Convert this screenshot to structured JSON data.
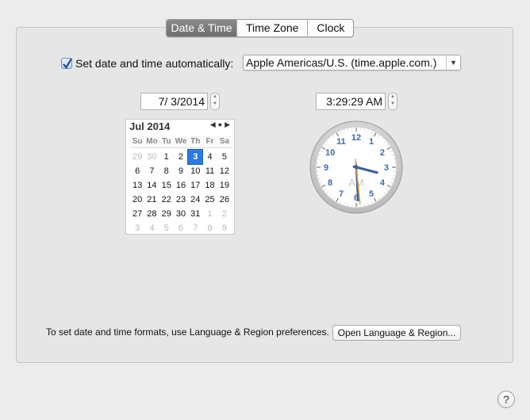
{
  "tabs": [
    "Date & Time",
    "Time Zone",
    "Clock"
  ],
  "active_tab": "Date & Time",
  "auto": {
    "checked": true,
    "label": "Set date and time automatically:"
  },
  "server": {
    "value": "Apple Americas/U.S. (time.apple.com.)"
  },
  "date_field": {
    "value": "7/  3/2014"
  },
  "time_field": {
    "value": "3:29:29 AM"
  },
  "calendar": {
    "title": "Jul 2014",
    "weekdays": [
      "Su",
      "Mo",
      "Tu",
      "We",
      "Th",
      "Fr",
      "Sa"
    ],
    "weeks": [
      [
        "29",
        "30",
        "1",
        "2",
        "3",
        "4",
        "5"
      ],
      [
        "6",
        "7",
        "8",
        "9",
        "10",
        "11",
        "12"
      ],
      [
        "13",
        "14",
        "15",
        "16",
        "17",
        "18",
        "19"
      ],
      [
        "20",
        "21",
        "22",
        "23",
        "24",
        "25",
        "26"
      ],
      [
        "27",
        "28",
        "29",
        "30",
        "31",
        "1",
        "2"
      ],
      [
        "3",
        "4",
        "5",
        "6",
        "7",
        "8",
        "9"
      ]
    ],
    "selected_day": "3"
  },
  "clock": {
    "numbers": [
      "12",
      "1",
      "2",
      "3",
      "4",
      "5",
      "6",
      "7",
      "8",
      "9",
      "10",
      "11"
    ],
    "ampm": "AM",
    "hour": 3,
    "minute": 29,
    "second": 29
  },
  "footer": {
    "text": "To set date and time formats, use Language & Region preferences.",
    "button": "Open Language & Region..."
  },
  "help": "?",
  "colors": {
    "selected_day": "#2c7be5",
    "clock_numbers": "#3a69b0",
    "second_hand": "#e0a030"
  }
}
